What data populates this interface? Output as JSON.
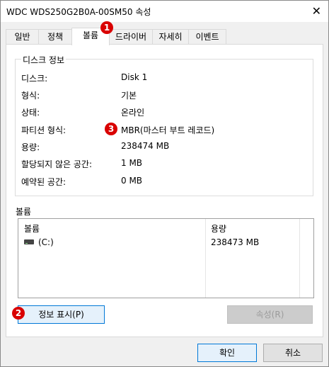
{
  "window": {
    "title": "WDC WDS250G2B0A-00SM50 속성",
    "close_glyph": "✕"
  },
  "tabs": [
    {
      "label": "일반"
    },
    {
      "label": "정책"
    },
    {
      "label": "볼륨"
    },
    {
      "label": "드라이버"
    },
    {
      "label": "자세히"
    },
    {
      "label": "이벤트"
    }
  ],
  "disk_info": {
    "group_title": "디스크 정보",
    "rows": [
      {
        "label": "디스크:",
        "value": "Disk 1"
      },
      {
        "label": "형식:",
        "value": "기본"
      },
      {
        "label": "상태:",
        "value": "온라인"
      },
      {
        "label": "파티션 형식:",
        "value": "MBR(마스터 부트 레코드)"
      },
      {
        "label": "용량:",
        "value": "238474 MB"
      },
      {
        "label": "할당되지 않은 공간:",
        "value": "1 MB"
      },
      {
        "label": "예약된 공간:",
        "value": "0 MB"
      }
    ]
  },
  "volumes": {
    "section_label": "볼륨",
    "columns": [
      "볼륨",
      "용량"
    ],
    "rows": [
      {
        "volume": "(C:)",
        "capacity": "238473 MB"
      }
    ]
  },
  "buttons": {
    "show_info": "정보 표시(P)",
    "properties": "속성(R)",
    "ok": "확인",
    "cancel": "취소"
  },
  "badges": {
    "b1": "1",
    "b2": "2",
    "b3": "3"
  },
  "colors": {
    "badge": "#d90000",
    "accent": "#0078d7"
  },
  "icons": {
    "drive": "drive-icon"
  }
}
